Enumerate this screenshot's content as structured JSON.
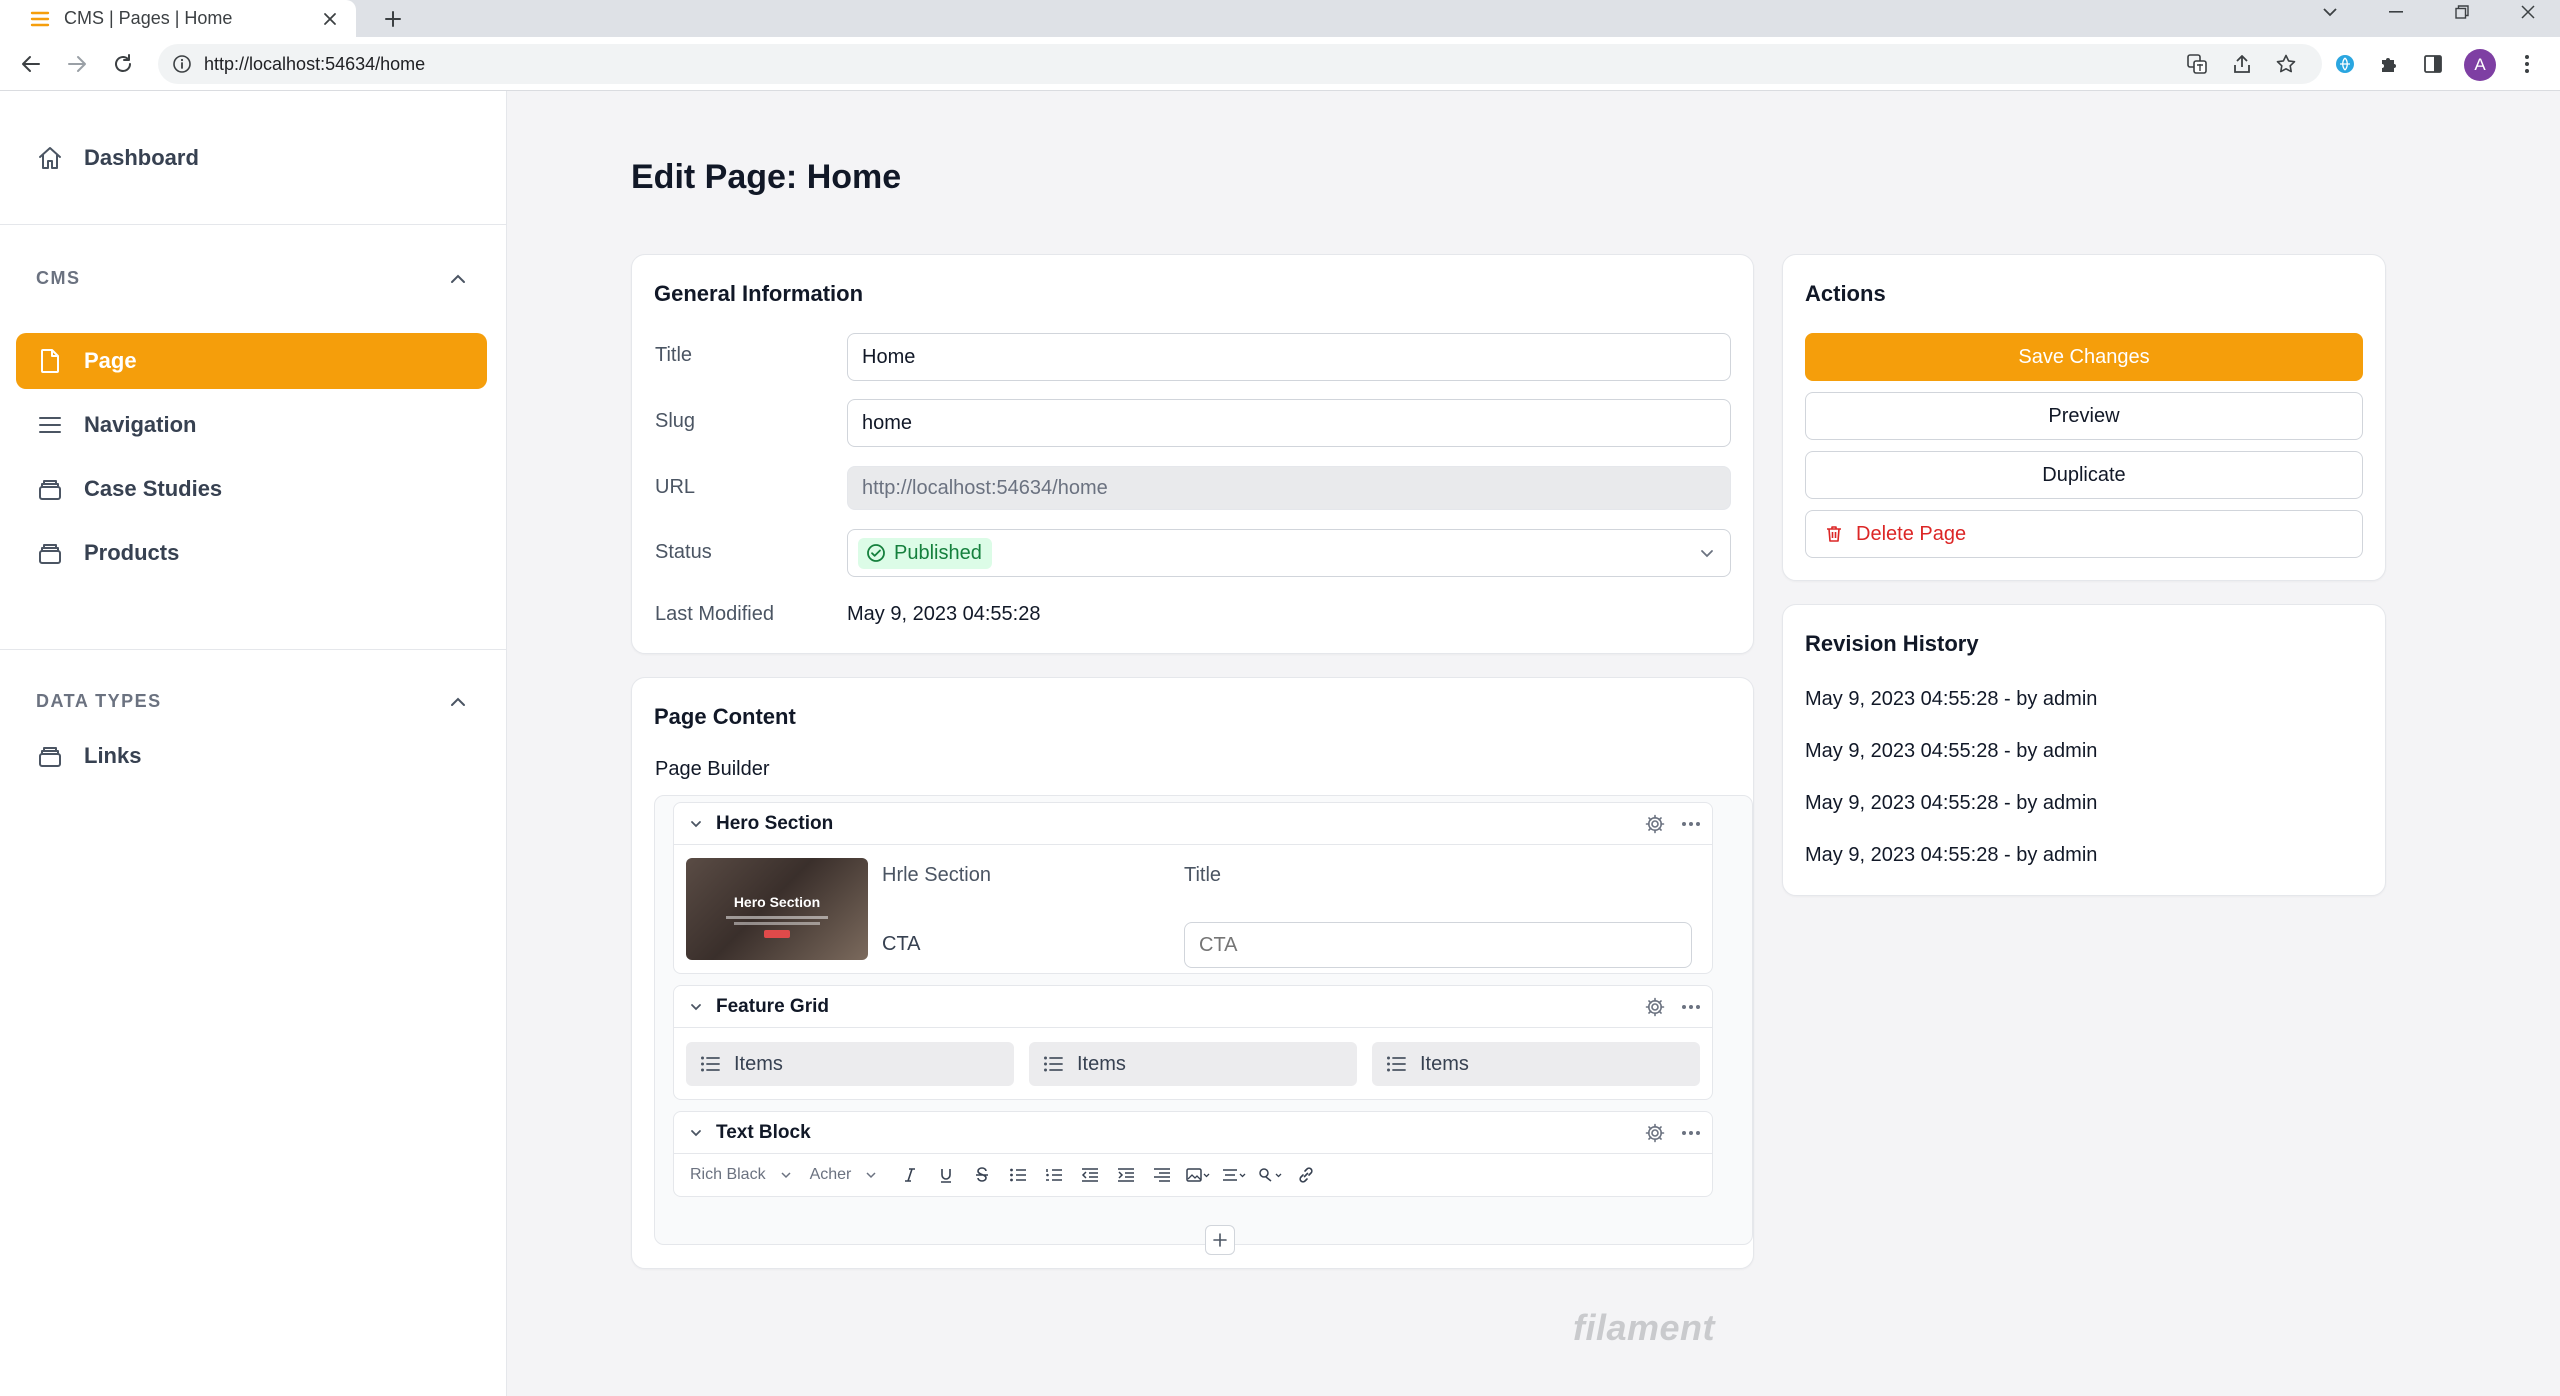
{
  "browser": {
    "tab_title": "CMS | Pages | Home",
    "url": "http://localhost:54634/home",
    "profile_initial": "A"
  },
  "sidebar": {
    "dashboard": "Dashboard",
    "groups": [
      {
        "label": "CMS",
        "items": [
          "Page",
          "Navigation",
          "Case Studies",
          "Products"
        ]
      },
      {
        "label": "DATA TYPES",
        "items": [
          "Links"
        ]
      }
    ],
    "active_item": "Page"
  },
  "page": {
    "title": "Edit Page: Home"
  },
  "general": {
    "heading": "General Information",
    "title_label": "Title",
    "title_value": "Home",
    "slug_label": "Slug",
    "slug_value": "home",
    "url_label": "URL",
    "url_value": "http://localhost:54634/home",
    "status_label": "Status",
    "status_value": "Published",
    "modified_label": "Last Modified",
    "modified_value": "May 9, 2023 04:55:28"
  },
  "content": {
    "heading": "Page Content",
    "builder_label": "Page Builder",
    "blocks": {
      "hero": {
        "name": "Hero Section",
        "thumb_text": "Hero Section",
        "section_label": "Hrle Section",
        "title_label": "Title",
        "cta_label": "CTA",
        "cta_placeholder": "CTA"
      },
      "grid": {
        "name": "Feature Grid",
        "items": [
          "Items",
          "Items",
          "Items"
        ]
      },
      "text": {
        "name": "Text Block",
        "font_select": "Rich Black",
        "style_select": "Acher"
      }
    }
  },
  "actions": {
    "heading": "Actions",
    "save": "Save Changes",
    "preview": "Preview",
    "duplicate": "Duplicate",
    "delete": "Delete Page"
  },
  "revisions": {
    "heading": "Revision History",
    "entries": [
      "May 9, 2023 04:55:28 - by admin",
      "May 9, 2023 04:55:28 - by admin",
      "May 9, 2023 04:55:28 - by admin",
      "May 9, 2023 04:55:28 - by admin"
    ]
  },
  "footer": {
    "brand": "filament"
  },
  "colors": {
    "accent": "#f59e0b",
    "success": "#15803d",
    "danger": "#dc2626"
  }
}
